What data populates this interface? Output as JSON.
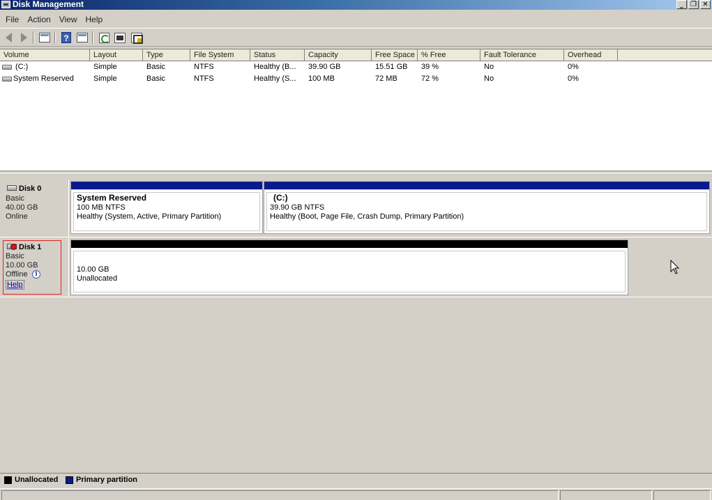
{
  "window": {
    "title": "Disk Management"
  },
  "menu": [
    "File",
    "Action",
    "View",
    "Help"
  ],
  "toolbar": {
    "icons": [
      "back-icon",
      "forward-icon",
      "show-hide-console-tree-icon",
      "help-icon",
      "show-hide-action-pane-icon",
      "refresh-icon",
      "properties-icon",
      "disk-properties-icon"
    ]
  },
  "volume_list": {
    "columns": [
      "Volume",
      "Layout",
      "Type",
      "File System",
      "Status",
      "Capacity",
      "Free Space",
      "% Free",
      "Fault Tolerance",
      "Overhead"
    ],
    "rows": [
      {
        "volume": "(C:)",
        "layout": "Simple",
        "type": "Basic",
        "fs": "NTFS",
        "status": "Healthy (B...",
        "capacity": "39.90 GB",
        "free": "15.51 GB",
        "pct_free": "39 %",
        "fault": "No",
        "overhead": "0%"
      },
      {
        "volume": "System Reserved",
        "layout": "Simple",
        "type": "Basic",
        "fs": "NTFS",
        "status": "Healthy (S...",
        "capacity": "100 MB",
        "free": "72 MB",
        "pct_free": "72 %",
        "fault": "No",
        "overhead": "0%"
      }
    ]
  },
  "disks": {
    "disk0": {
      "name": "Disk 0",
      "type": "Basic",
      "size": "40.00 GB",
      "state": "Online",
      "partitions": [
        {
          "title": "System Reserved",
          "line1": "100 MB NTFS",
          "line2": "Healthy (System, Active, Primary Partition)",
          "bar_color": "#0a1a8c"
        },
        {
          "title": "(C:)",
          "line1": "39.90 GB NTFS",
          "line2": "Healthy (Boot, Page File, Crash Dump, Primary Partition)",
          "bar_color": "#0a1a8c"
        }
      ]
    },
    "disk1": {
      "name": "Disk 1",
      "type": "Basic",
      "size": "10.00 GB",
      "state": "Offline",
      "help_link": "Help",
      "partitions": [
        {
          "line1": "10.00 GB",
          "line2": "Unallocated",
          "bar_color": "#000000"
        }
      ]
    }
  },
  "legend": [
    {
      "label": "Unallocated",
      "color": "#000000"
    },
    {
      "label": "Primary partition",
      "color": "#0a1a8c"
    }
  ]
}
